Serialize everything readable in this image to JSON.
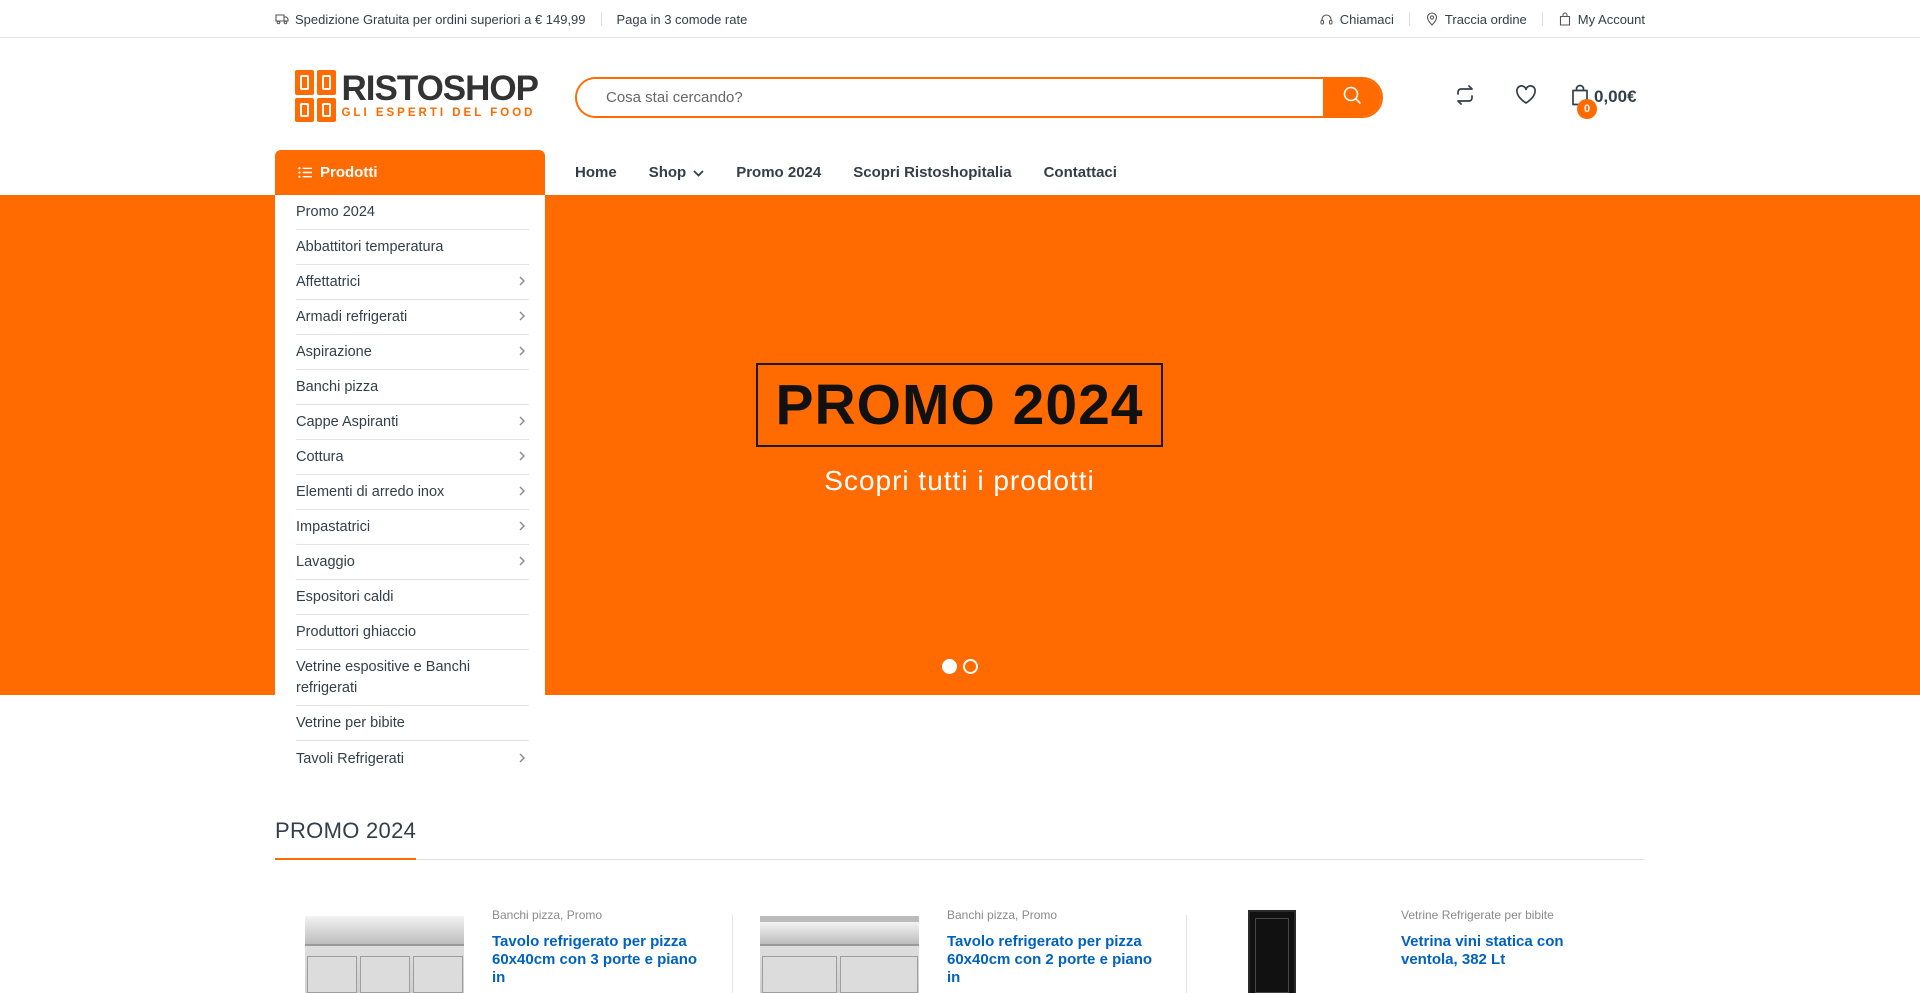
{
  "topbar": {
    "shipping": "Spedizione Gratuita per ordini superiori a € 149,99",
    "installments": "Paga in 3 comode rate",
    "call": "Chiamaci",
    "track": "Traccia ordine",
    "account": "My Account"
  },
  "brand": {
    "name": "RISTOSHOP",
    "tagline": "GLI ESPERTI DEL FOOD",
    "accent_color": "#ff6b00"
  },
  "search": {
    "placeholder": "Cosa stai cercando?"
  },
  "cart": {
    "count": "0",
    "total": "0,00€"
  },
  "header_icons": [
    "compare-icon",
    "heart-icon",
    "shopping-bag-icon"
  ],
  "nav": {
    "products_label": "Prodotti",
    "items": [
      "Home",
      "Shop",
      "Promo 2024",
      "Scopri Ristoshopitalia",
      "Contattaci"
    ]
  },
  "categories": [
    {
      "label": "Promo 2024",
      "has_children": false
    },
    {
      "label": "Abbattitori temperatura",
      "has_children": false
    },
    {
      "label": "Affettatrici",
      "has_children": true
    },
    {
      "label": "Armadi refrigerati",
      "has_children": true
    },
    {
      "label": "Aspirazione",
      "has_children": true
    },
    {
      "label": "Banchi pizza",
      "has_children": false
    },
    {
      "label": "Cappe Aspiranti",
      "has_children": true
    },
    {
      "label": "Cottura",
      "has_children": true
    },
    {
      "label": "Elementi di arredo inox",
      "has_children": true
    },
    {
      "label": "Impastatrici",
      "has_children": true
    },
    {
      "label": "Lavaggio",
      "has_children": true
    },
    {
      "label": "Espositori caldi",
      "has_children": false
    },
    {
      "label": "Produttori ghiaccio",
      "has_children": false
    },
    {
      "label": "Vetrine espositive e Banchi refrigerati",
      "has_children": false
    },
    {
      "label": "Vetrine per bibite",
      "has_children": false
    },
    {
      "label": "Tavoli Refrigerati",
      "has_children": true
    }
  ],
  "hero": {
    "title": "PROMO 2024",
    "subtitle": "Scopri tutti i prodotti",
    "slides": 2,
    "active_slide": 1
  },
  "promo_section": {
    "title": "PROMO 2024",
    "products": [
      {
        "cat1": "Banchi pizza",
        "cat2": "Promo",
        "title": "Tavolo refrigerato per pizza 60x40cm con 3 porte e piano in"
      },
      {
        "cat1": "Banchi pizza",
        "cat2": "Promo",
        "title": "Tavolo refrigerato per pizza 60x40cm con 2 porte e piano in"
      },
      {
        "cat1": "Vetrine Refrigerate per bibite",
        "cat2": "",
        "title": "Vetrina vini statica con ventola, 382 Lt"
      }
    ]
  }
}
